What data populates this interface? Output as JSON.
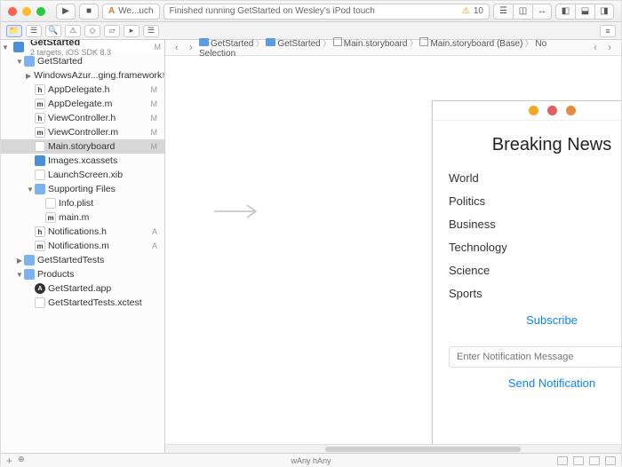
{
  "titlebar": {
    "scheme": "We...uch",
    "status": "Finished running GetStarted on Wesley's iPod touch",
    "warnings": "10"
  },
  "project": {
    "name": "GetStarted",
    "subtitle": "2 targets, iOS SDK 8.3",
    "status": "M"
  },
  "tree": [
    {
      "d": 1,
      "open": true,
      "icon": "folder",
      "name": "GetStarted",
      "status": ""
    },
    {
      "d": 2,
      "open": false,
      "icon": "framework",
      "name": "WindowsAzur...ging.framework",
      "status": "M"
    },
    {
      "d": 2,
      "icon": "h",
      "glyph": "h",
      "name": "AppDelegate.h",
      "status": "M"
    },
    {
      "d": 2,
      "icon": "m",
      "glyph": "m",
      "name": "AppDelegate.m",
      "status": "M"
    },
    {
      "d": 2,
      "icon": "h",
      "glyph": "h",
      "name": "ViewController.h",
      "status": "M"
    },
    {
      "d": 2,
      "icon": "m",
      "glyph": "m",
      "name": "ViewController.m",
      "status": "M"
    },
    {
      "d": 2,
      "icon": "sb",
      "name": "Main.storyboard",
      "status": "M",
      "sel": true
    },
    {
      "d": 2,
      "icon": "assets",
      "name": "Images.xcassets",
      "status": ""
    },
    {
      "d": 2,
      "icon": "xib",
      "name": "LaunchScreen.xib",
      "status": ""
    },
    {
      "d": 2,
      "open": true,
      "icon": "folder",
      "name": "Supporting Files",
      "status": ""
    },
    {
      "d": 3,
      "icon": "plist",
      "name": "Info.plist",
      "status": ""
    },
    {
      "d": 3,
      "icon": "m",
      "glyph": "m",
      "name": "main.m",
      "status": ""
    },
    {
      "d": 2,
      "icon": "h",
      "glyph": "h",
      "name": "Notifications.h",
      "status": "A"
    },
    {
      "d": 2,
      "icon": "m",
      "glyph": "m",
      "name": "Notifications.m",
      "status": "A"
    },
    {
      "d": 1,
      "open": false,
      "icon": "folder",
      "name": "GetStartedTests",
      "status": ""
    },
    {
      "d": 1,
      "open": true,
      "icon": "folder",
      "name": "Products",
      "status": ""
    },
    {
      "d": 2,
      "icon": "app",
      "name": "GetStarted.app",
      "status": ""
    },
    {
      "d": 2,
      "icon": "xctest",
      "name": "GetStartedTests.xctest",
      "status": ""
    }
  ],
  "breadcrumbs": [
    "GetStarted",
    "GetStarted",
    "Main.storyboard",
    "Main.storyboard (Base)",
    "No Selection"
  ],
  "scene": {
    "title": "Breaking News",
    "categories": [
      "World",
      "Politics",
      "Business",
      "Technology",
      "Science",
      "Sports"
    ],
    "subscribe": "Subscribe",
    "input_placeholder": "Enter Notification Message",
    "send": "Send Notification"
  },
  "sizeclass": "wAny hAny"
}
